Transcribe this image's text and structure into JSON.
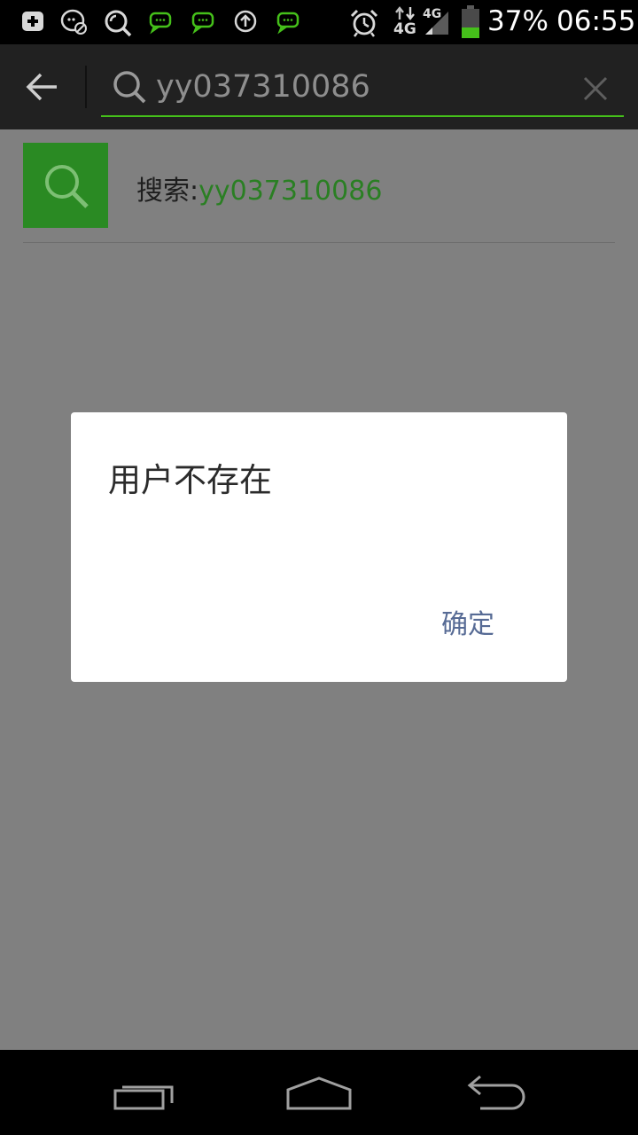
{
  "status_bar": {
    "battery_percent": "37%",
    "time": "06:55",
    "network_top": "4G",
    "network_bottom": "4G",
    "icons": [
      "add-notification-icon",
      "chat-muted-icon",
      "search-app-icon",
      "wechat-message-icon",
      "wechat-message-icon",
      "sync-icon",
      "wechat-message-icon",
      "alarm-icon",
      "data-arrows-icon",
      "signal-icon",
      "battery-icon"
    ],
    "battery_color": "#45c01a"
  },
  "header": {
    "back_icon": "arrow-left-icon",
    "search_icon": "search-icon",
    "search_value": "yy037310086",
    "clear_icon": "close-icon",
    "accent_color": "#45c01a"
  },
  "result": {
    "label_prefix": "搜索:",
    "query": "yy037310086",
    "icon": "search-icon",
    "icon_bg_color": "#2a8a23"
  },
  "dialog": {
    "message": "用户不存在",
    "ok_label": "确定",
    "ok_color": "#576b95"
  },
  "nav_bar": {
    "recent_apps_icon": "recent-apps-icon",
    "home_icon": "home-icon",
    "back_icon": "back-icon"
  }
}
